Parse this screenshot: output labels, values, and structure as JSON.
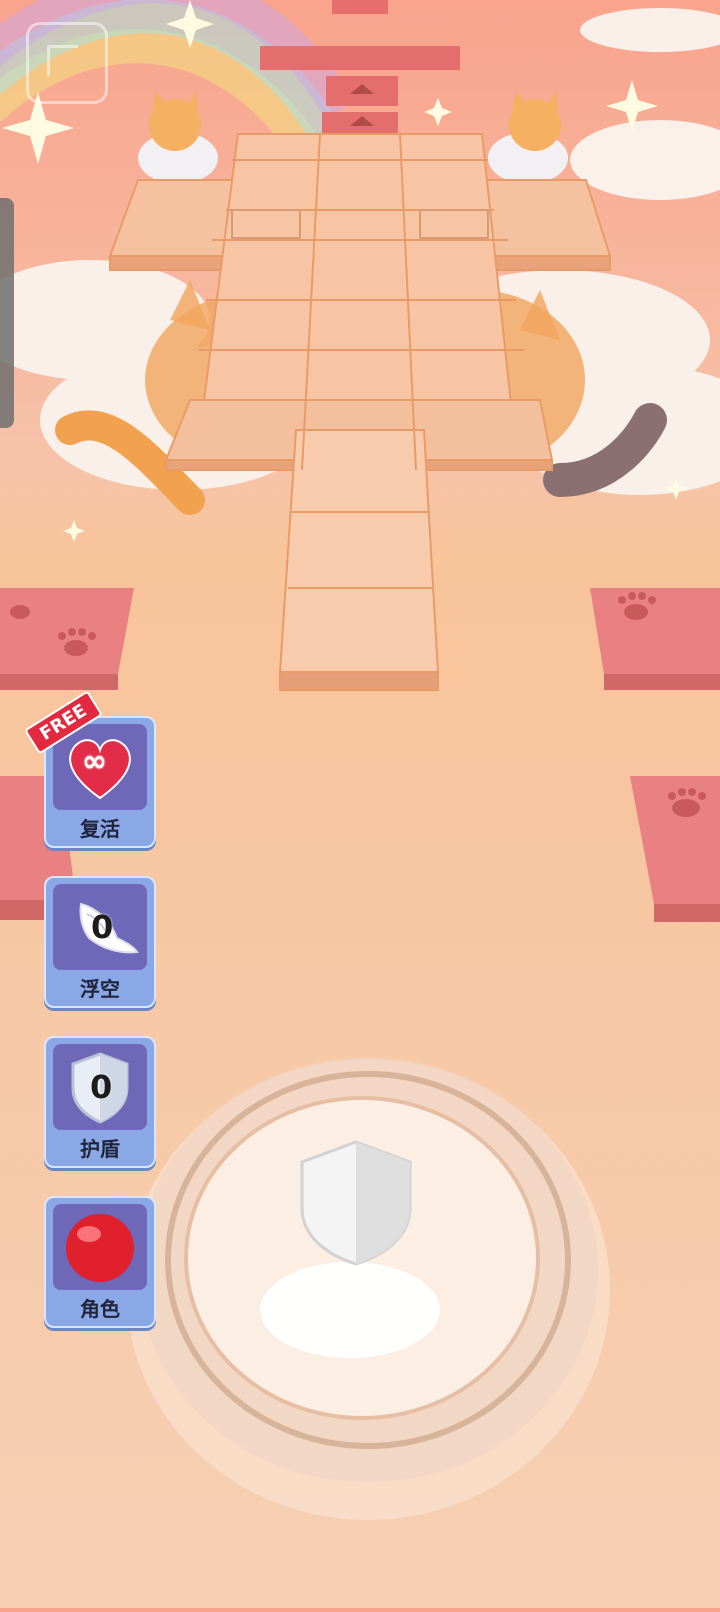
{
  "hud": {
    "free_badge": "FREE",
    "revive": {
      "label": "复活",
      "symbol": "∞",
      "icon": "infinity-heart-icon"
    },
    "float": {
      "label": "浮空",
      "count": "0",
      "icon": "wing-icon"
    },
    "shield": {
      "label": "护盾",
      "count": "0",
      "icon": "shield-icon"
    },
    "character": {
      "label": "角色",
      "icon": "red-ball-icon"
    }
  },
  "colors": {
    "button_blue": "#8aa7e6",
    "button_inner": "#6f67b7",
    "heart_red": "#e22c48",
    "ball_red": "#e0202c",
    "tile_orange": "#f5c09a",
    "paw_tile": "#e97f80"
  },
  "icons": [
    "cat-icon",
    "paw-icon",
    "sparkle-icon",
    "rainbow-icon",
    "shield-icon"
  ]
}
